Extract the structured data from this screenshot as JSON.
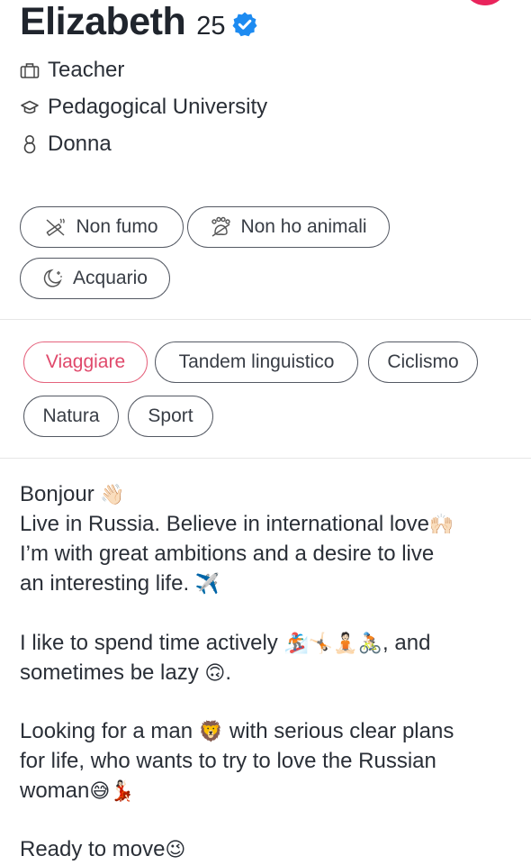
{
  "profile": {
    "name": "Elizabeth",
    "age": "25",
    "job": "Teacher",
    "school": "Pedagogical University",
    "gender": "Donna"
  },
  "lifestyle_chips": [
    {
      "label": "Non fumo",
      "icon": "no-smoking-icon"
    },
    {
      "label": "Non ho animali",
      "icon": "paw-icon"
    },
    {
      "label": "Acquario",
      "icon": "moon-stars-icon"
    }
  ],
  "interest_chips": [
    {
      "label": "Viaggiare",
      "highlighted": true
    },
    {
      "label": "Tandem linguistico",
      "highlighted": false
    },
    {
      "label": "Ciclismo",
      "highlighted": false
    },
    {
      "label": "Natura",
      "highlighted": false
    },
    {
      "label": "Sport",
      "highlighted": false
    }
  ],
  "bio": {
    "line1": "Bonjour",
    "line2": "Live in Russia. Believe in international love",
    "line3": "I’m with great ambitions and a desire to live",
    "line4": "an interesting life.",
    "line5_a": "I like to spend time actively",
    "line5_b": ", and",
    "line6": "sometimes be lazy",
    "line6_end": ".",
    "line7_a": "Looking for a man",
    "line7_b": " with serious clear plans",
    "line8": "for life, who wants to try to love the Russian",
    "line9": "woman",
    "line10": "Ready to move"
  },
  "emojis": {
    "wave": "👋🏻",
    "raised_hands": "🙌🏻",
    "airplane": "✈️",
    "activities": "🏂🏻🤸🏻🧘🏻🚴🏻",
    "upside_down": "🙃",
    "lion": "🦁",
    "grin_sweat": "😅",
    "dancer": "💃🏻",
    "wink": "😉"
  },
  "colors": {
    "accent": "#e9245c",
    "verified": "#1d8bf1",
    "highlight_chip": "#e5637d",
    "chip_border": "#545963",
    "text": "#2a2f37"
  }
}
